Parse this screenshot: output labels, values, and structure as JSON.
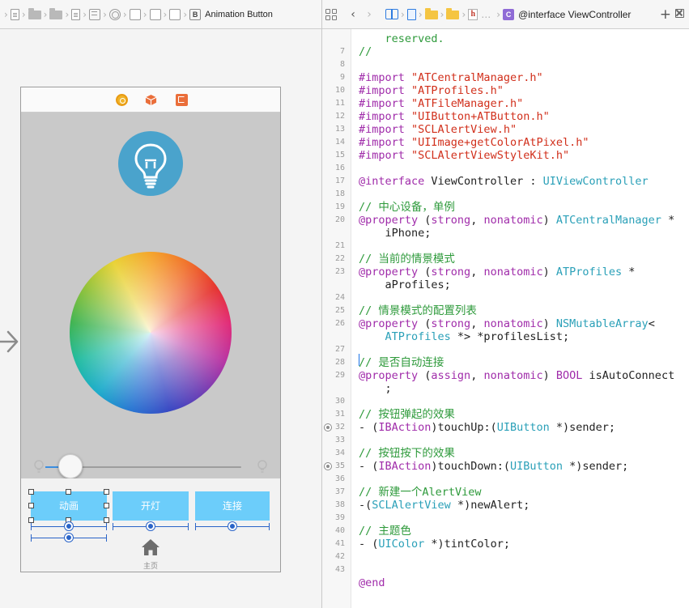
{
  "colors": {
    "comment": "#2e9a3b",
    "keyword": "#a02caa",
    "string": "#d12f1b",
    "class_name": "#2aa0b8",
    "scene_button": "#6ccdfa",
    "bulb_circle": "#4aa3cc",
    "constraint": "#2a64c8"
  },
  "left_jump_bar": {
    "items": [
      "file-icon",
      "folder-icon",
      "folder-icon",
      "file-icon",
      "view-controller-icon",
      "circle-icon",
      "view-icon",
      "view-icon",
      "view-icon"
    ],
    "last_label": "Animation Button",
    "last_icon_letter": "B"
  },
  "scene": {
    "dock_icons": [
      "first-responder-icon",
      "cube-icon",
      "exit-icon"
    ],
    "buttons": {
      "animation": "动画",
      "light": "开灯",
      "connect": "连接"
    },
    "tab_bar": {
      "home_label": "主页"
    },
    "slider_value": 0.0
  },
  "right_jump_bar": {
    "title": "@interface ViewController",
    "ellipsis": "…",
    "header_letter": "h",
    "class_letter": "C",
    "add_symbol": "+"
  },
  "code": {
    "lines": [
      {
        "n": "",
        "parts": [
          {
            "c": "cm",
            "t": "    reserved."
          }
        ]
      },
      {
        "n": "7",
        "parts": [
          {
            "c": "cm",
            "t": "//"
          }
        ]
      },
      {
        "n": "8",
        "parts": []
      },
      {
        "n": "9",
        "parts": [
          {
            "c": "kw",
            "t": "#import "
          },
          {
            "c": "str",
            "t": "\"ATCentralManager.h\""
          }
        ]
      },
      {
        "n": "10",
        "parts": [
          {
            "c": "kw",
            "t": "#import "
          },
          {
            "c": "str",
            "t": "\"ATProfiles.h\""
          }
        ]
      },
      {
        "n": "11",
        "parts": [
          {
            "c": "kw",
            "t": "#import "
          },
          {
            "c": "str",
            "t": "\"ATFileManager.h\""
          }
        ]
      },
      {
        "n": "12",
        "parts": [
          {
            "c": "kw",
            "t": "#import "
          },
          {
            "c": "str",
            "t": "\"UIButton+ATButton.h\""
          }
        ]
      },
      {
        "n": "13",
        "parts": [
          {
            "c": "kw",
            "t": "#import "
          },
          {
            "c": "str",
            "t": "\"SCLAlertView.h\""
          }
        ]
      },
      {
        "n": "14",
        "parts": [
          {
            "c": "kw",
            "t": "#import "
          },
          {
            "c": "str",
            "t": "\"UIImage+getColorAtPixel.h\""
          }
        ]
      },
      {
        "n": "15",
        "parts": [
          {
            "c": "kw",
            "t": "#import "
          },
          {
            "c": "str",
            "t": "\"SCLAlertViewStyleKit.h\""
          }
        ]
      },
      {
        "n": "16",
        "parts": []
      },
      {
        "n": "17",
        "parts": [
          {
            "c": "kw",
            "t": "@interface"
          },
          {
            "c": "plain",
            "t": " ViewController : "
          },
          {
            "c": "cls",
            "t": "UIViewController"
          }
        ]
      },
      {
        "n": "18",
        "parts": []
      },
      {
        "n": "19",
        "parts": [
          {
            "c": "cm",
            "t": "// 中心设备，单例"
          }
        ]
      },
      {
        "n": "20",
        "parts": [
          {
            "c": "kw",
            "t": "@property"
          },
          {
            "c": "plain",
            "t": " ("
          },
          {
            "c": "kw",
            "t": "strong"
          },
          {
            "c": "plain",
            "t": ", "
          },
          {
            "c": "kw",
            "t": "nonatomic"
          },
          {
            "c": "plain",
            "t": ") "
          },
          {
            "c": "cls",
            "t": "ATCentralManager"
          },
          {
            "c": "plain",
            "t": " *"
          }
        ]
      },
      {
        "n": "",
        "parts": [
          {
            "c": "plain",
            "t": "    iPhone;"
          }
        ]
      },
      {
        "n": "21",
        "parts": []
      },
      {
        "n": "22",
        "parts": [
          {
            "c": "cm",
            "t": "// 当前的情景模式"
          }
        ]
      },
      {
        "n": "23",
        "parts": [
          {
            "c": "kw",
            "t": "@property"
          },
          {
            "c": "plain",
            "t": " ("
          },
          {
            "c": "kw",
            "t": "strong"
          },
          {
            "c": "plain",
            "t": ", "
          },
          {
            "c": "kw",
            "t": "nonatomic"
          },
          {
            "c": "plain",
            "t": ") "
          },
          {
            "c": "cls",
            "t": "ATProfiles"
          },
          {
            "c": "plain",
            "t": " *"
          }
        ]
      },
      {
        "n": "",
        "parts": [
          {
            "c": "plain",
            "t": "    aProfiles;"
          }
        ]
      },
      {
        "n": "24",
        "parts": []
      },
      {
        "n": "25",
        "parts": [
          {
            "c": "cm",
            "t": "// 情景模式的配置列表"
          }
        ]
      },
      {
        "n": "26",
        "parts": [
          {
            "c": "kw",
            "t": "@property"
          },
          {
            "c": "plain",
            "t": " ("
          },
          {
            "c": "kw",
            "t": "strong"
          },
          {
            "c": "plain",
            "t": ", "
          },
          {
            "c": "kw",
            "t": "nonatomic"
          },
          {
            "c": "plain",
            "t": ") "
          },
          {
            "c": "cls",
            "t": "NSMutableArray"
          },
          {
            "c": "plain",
            "t": "<"
          }
        ]
      },
      {
        "n": "",
        "parts": [
          {
            "c": "plain",
            "t": "    "
          },
          {
            "c": "cls",
            "t": "ATProfiles"
          },
          {
            "c": "plain",
            "t": " *> *profilesList;"
          }
        ]
      },
      {
        "n": "27",
        "parts": []
      },
      {
        "n": "28",
        "parts": [
          {
            "c": "cm",
            "t": "// 是否自动连接"
          }
        ]
      },
      {
        "n": "29",
        "parts": [
          {
            "c": "kw",
            "t": "@property"
          },
          {
            "c": "plain",
            "t": " ("
          },
          {
            "c": "kw",
            "t": "assign"
          },
          {
            "c": "plain",
            "t": ", "
          },
          {
            "c": "kw",
            "t": "nonatomic"
          },
          {
            "c": "plain",
            "t": ") "
          },
          {
            "c": "kw",
            "t": "BOOL"
          },
          {
            "c": "plain",
            "t": " isAutoConnect"
          }
        ]
      },
      {
        "n": "",
        "parts": [
          {
            "c": "plain",
            "t": "    ;"
          }
        ]
      },
      {
        "n": "30",
        "parts": []
      },
      {
        "n": "31",
        "parts": [
          {
            "c": "cm",
            "t": "// 按钮弹起的效果"
          }
        ]
      },
      {
        "n": "32",
        "dot": true,
        "parts": [
          {
            "c": "plain",
            "t": "- ("
          },
          {
            "c": "kw",
            "t": "IBAction"
          },
          {
            "c": "plain",
            "t": ")touchUp:("
          },
          {
            "c": "cls",
            "t": "UIButton"
          },
          {
            "c": "plain",
            "t": " *)sender;"
          }
        ]
      },
      {
        "n": "33",
        "parts": []
      },
      {
        "n": "34",
        "parts": [
          {
            "c": "cm",
            "t": "// 按钮按下的效果"
          }
        ]
      },
      {
        "n": "35",
        "dot": true,
        "parts": [
          {
            "c": "plain",
            "t": "- ("
          },
          {
            "c": "kw",
            "t": "IBAction"
          },
          {
            "c": "plain",
            "t": ")touchDown:("
          },
          {
            "c": "cls",
            "t": "UIButton"
          },
          {
            "c": "plain",
            "t": " *)sender;"
          }
        ]
      },
      {
        "n": "36",
        "parts": []
      },
      {
        "n": "37",
        "parts": [
          {
            "c": "cm",
            "t": "// 新建一个AlertView"
          }
        ]
      },
      {
        "n": "38",
        "parts": [
          {
            "c": "plain",
            "t": "-("
          },
          {
            "c": "cls",
            "t": "SCLAlertView"
          },
          {
            "c": "plain",
            "t": " *)newAlert;"
          }
        ]
      },
      {
        "n": "39",
        "parts": []
      },
      {
        "n": "40",
        "parts": [
          {
            "c": "cm",
            "t": "// 主题色"
          }
        ]
      },
      {
        "n": "41",
        "parts": [
          {
            "c": "plain",
            "t": "- ("
          },
          {
            "c": "cls",
            "t": "UIColor"
          },
          {
            "c": "plain",
            "t": " *)tintColor;"
          }
        ]
      },
      {
        "n": "42",
        "parts": []
      },
      {
        "n": "43",
        "parts": []
      },
      {
        "n": "",
        "parts": [
          {
            "c": "kw",
            "t": "@end"
          }
        ]
      }
    ]
  }
}
